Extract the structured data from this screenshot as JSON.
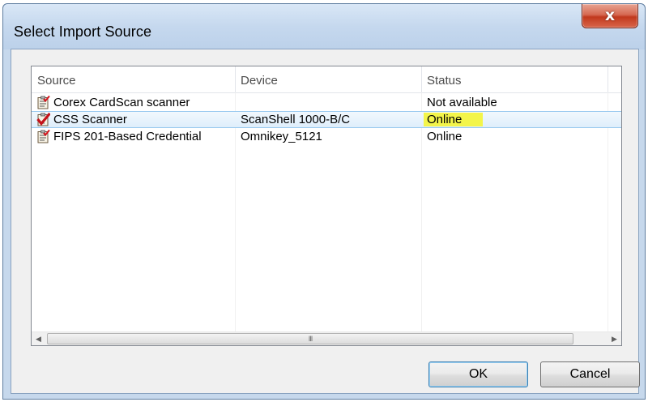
{
  "window": {
    "title": "Select Import Source",
    "close_glyph": "x"
  },
  "list": {
    "columns": [
      "Source",
      "Device",
      "Status"
    ],
    "rows": [
      {
        "source": "Corex CardScan scanner",
        "device": "",
        "status": "Not available",
        "icon": "clipboard-check-icon",
        "selected": false
      },
      {
        "source": "CSS Scanner",
        "device": "ScanShell 1000-B/C",
        "status": "Online",
        "icon": "red-checkmark-clipboard-icon",
        "selected": true,
        "status_highlight": "#f3f54a"
      },
      {
        "source": "FIPS 201-Based Credential",
        "device": "Omnikey_5121",
        "status": "Online",
        "icon": "clipboard-check-icon",
        "selected": false
      }
    ]
  },
  "scrollbar": {
    "left_arrow": "◀",
    "right_arrow": "▶",
    "grip": "III"
  },
  "buttons": {
    "ok": "OK",
    "cancel": "Cancel"
  },
  "colors": {
    "selection": "#dfeefb",
    "highlight": "#f3f54a",
    "close_button": "#c1391d"
  }
}
